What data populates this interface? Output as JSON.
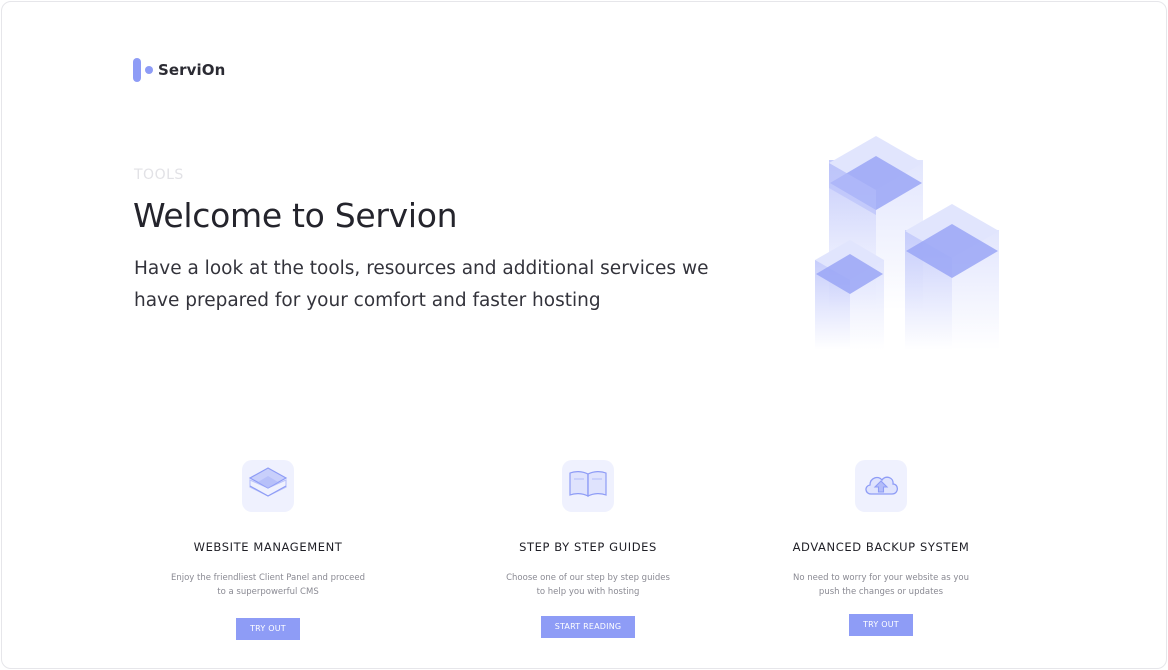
{
  "brand": {
    "name": "ServiOn",
    "color": "#8e9cf6"
  },
  "hero": {
    "eyebrow": "TOOLS",
    "title": "Welcome to Servion",
    "subtitle": "Have a look at the tools, resources and additional services we have prepared for your comfort and faster hosting"
  },
  "features": [
    {
      "icon": "layers-icon",
      "title": "WEBSITE MANAGEMENT",
      "description_line1": "Enjoy the friendliest Client Panel and proceed",
      "description_line2": "to a superpowerful CMS",
      "button": "TRY OUT"
    },
    {
      "icon": "book-icon",
      "title": "STEP BY STEP GUIDES",
      "description_line1": "Choose one of our step by step guides",
      "description_line2": "to help you with hosting",
      "button": "START READING"
    },
    {
      "icon": "cloud-upload-icon",
      "title": "ADVANCED BACKUP SYSTEM",
      "description_line1": "No need to worry for your website as you",
      "description_line2": "push the changes or updates",
      "button": "TRY OUT"
    }
  ]
}
